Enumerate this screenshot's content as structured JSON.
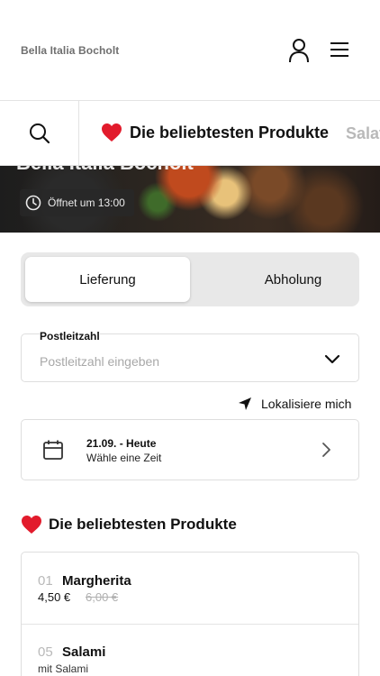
{
  "header": {
    "brand": "Bella Italia Bocholt",
    "user_icon": "user-icon",
    "menu_icon": "hamburger-menu-icon"
  },
  "category_bar": {
    "search_icon": "search-icon",
    "active": {
      "emoji": "heart",
      "label": "Die beliebtesten Produkte"
    },
    "next": {
      "label": "Salat"
    }
  },
  "hero": {
    "title": "Bella Italia Bocholt",
    "status": "Öffnet um 13:00",
    "status_icon": "clock-icon"
  },
  "delivery_toggle": {
    "options": [
      "Lieferung",
      "Abholung"
    ],
    "selected": "Lieferung"
  },
  "postcode": {
    "label": "Postleitzahl",
    "placeholder": "Postleitzahl eingeben"
  },
  "locate": {
    "label": "Lokalisiere mich",
    "icon": "location-arrow-icon"
  },
  "date": {
    "title": "21.09. - Heute",
    "subtitle": "Wähle eine Zeit",
    "icon": "calendar-icon"
  },
  "popular": {
    "title": "Die beliebtesten Produkte",
    "items": [
      {
        "number": "01",
        "name": "Margherita",
        "price": "4,50 €",
        "old_price": "6,00 €"
      },
      {
        "number": "05",
        "name": "Salami",
        "description": "mit Salami"
      }
    ]
  },
  "colors": {
    "heart": "#e21b2c",
    "border": "#dedede",
    "muted_text": "#b9b9b9",
    "toggle_bg": "#e8e8e8"
  }
}
